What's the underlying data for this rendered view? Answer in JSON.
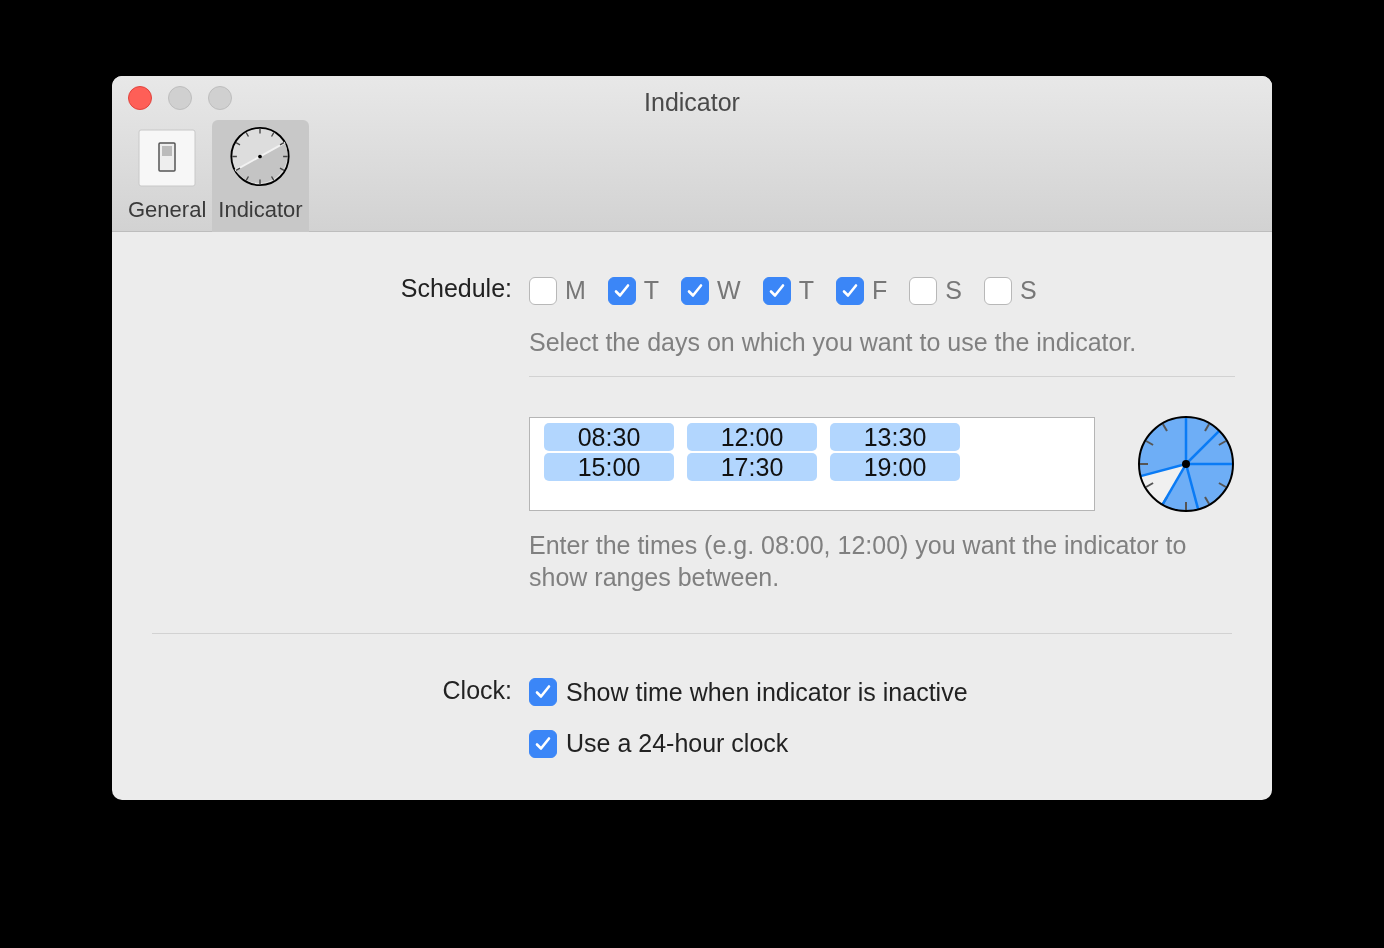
{
  "window": {
    "title": "Indicator"
  },
  "toolbar": [
    {
      "label": "General",
      "kind": "switch",
      "selected": false
    },
    {
      "label": "Indicator",
      "kind": "clock",
      "selected": true
    }
  ],
  "schedule": {
    "label": "Schedule:",
    "days": [
      {
        "label": "M",
        "checked": false
      },
      {
        "label": "T",
        "checked": true
      },
      {
        "label": "W",
        "checked": true
      },
      {
        "label": "T",
        "checked": true
      },
      {
        "label": "F",
        "checked": true
      },
      {
        "label": "S",
        "checked": false
      },
      {
        "label": "S",
        "checked": false
      }
    ],
    "hint": "Select the days on which you want to use the indicator."
  },
  "times": {
    "tokens": [
      [
        "08:30",
        "12:00",
        "13:30"
      ],
      [
        "15:00",
        "17:30",
        "19:00"
      ]
    ],
    "hint": "Enter the times (e.g. 08:00, 12:00) you want the indicator to show ranges between."
  },
  "clock": {
    "label": "Clock:",
    "options": [
      {
        "label": "Show time when indicator is inactive",
        "checked": true
      },
      {
        "label": "Use a 24-hour clock",
        "checked": true
      }
    ]
  }
}
